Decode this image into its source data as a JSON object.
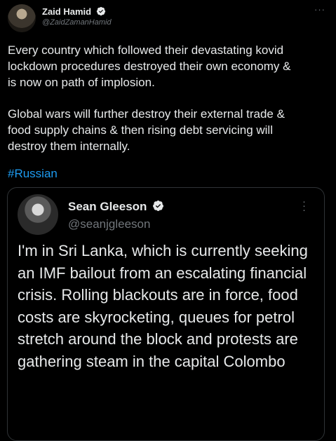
{
  "tweet": {
    "author_name": "Zaid Hamid",
    "author_handle": "@ZaidZamanHamid",
    "paragraph1": "Every country which followed their devastating kovid\nlockdown procedures destroyed their own economy &\nis now on path of implosion.",
    "paragraph2": "Global wars will further destroy their external trade &\nfood supply chains & then rising debt servicing will\ndestroy them internally.",
    "hashtag": "#Russian",
    "more_label": "···"
  },
  "quoted": {
    "author_name": "Sean Gleeson",
    "author_handle": "@seanjgleeson",
    "text": "I'm in Sri Lanka, which is currently seeking an IMF bailout from an escalating financial crisis. Rolling blackouts are in force, food costs are skyrocketing, queues for petrol stretch around the block and protests are gathering steam in the capital Colombo",
    "more_label": "·\n·\n·"
  },
  "colors": {
    "background": "#000000",
    "link": "#1d9bf0",
    "muted": "#71767b",
    "text": "#e7e9ea"
  },
  "icons": {
    "verified": "verified-badge-icon",
    "more": "more-options-icon"
  }
}
